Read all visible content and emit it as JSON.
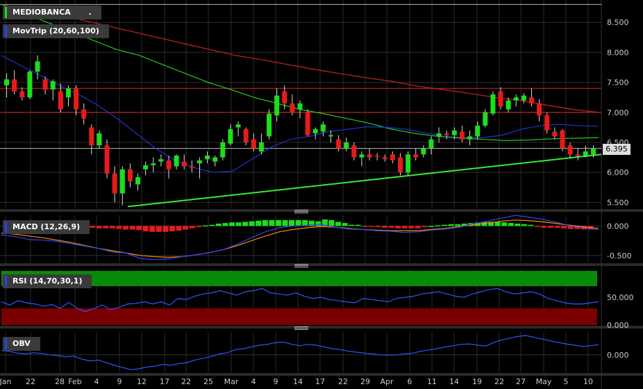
{
  "chart_data": [
    {
      "type": "candlestick",
      "title": "MEDIOBANCA",
      "title_suffix": ".",
      "overlay_label": "MovTrip (20,60,100)",
      "y_ticks": [
        "8.500",
        "8.000",
        "7.500",
        "7.000",
        "6.500",
        "6.000",
        "5.500"
      ],
      "ylim": [
        5.4,
        8.85
      ],
      "last_price": "6.395",
      "x_ticks": [
        "Jan",
        "22",
        "28",
        "Feb",
        "4",
        "9",
        "12",
        "17",
        "22",
        "25",
        "Mar",
        "4",
        "9",
        "14",
        "17",
        "22",
        "29",
        "Apr",
        "6",
        "11",
        "14",
        "19",
        "22",
        "27",
        "May",
        "5",
        "10"
      ],
      "candles": [
        [
          7.45,
          7.65,
          7.25,
          7.55
        ],
        [
          7.55,
          7.7,
          7.3,
          7.35
        ],
        [
          7.35,
          7.42,
          7.2,
          7.25
        ],
        [
          7.25,
          7.7,
          7.22,
          7.68
        ],
        [
          7.68,
          7.95,
          7.55,
          7.85
        ],
        [
          7.55,
          7.6,
          7.3,
          7.38
        ],
        [
          7.38,
          7.55,
          7.2,
          7.52
        ],
        [
          7.35,
          7.48,
          7.0,
          7.05
        ],
        [
          7.25,
          7.45,
          7.1,
          7.4
        ],
        [
          7.4,
          7.45,
          6.95,
          7.05
        ],
        [
          7.05,
          7.15,
          6.8,
          6.9
        ],
        [
          6.75,
          6.8,
          6.3,
          6.45
        ],
        [
          6.45,
          6.7,
          6.4,
          6.65
        ],
        [
          6.45,
          6.55,
          5.9,
          5.98
        ],
        [
          5.98,
          6.1,
          5.5,
          5.65
        ],
        [
          5.65,
          6.1,
          5.45,
          6.05
        ],
        [
          6.05,
          6.15,
          5.75,
          5.85
        ],
        [
          5.8,
          5.98,
          5.7,
          5.92
        ],
        [
          6.05,
          6.18,
          5.95,
          6.12
        ],
        [
          6.12,
          6.25,
          6.0,
          6.15
        ],
        [
          6.18,
          6.3,
          6.1,
          6.22
        ],
        [
          6.2,
          6.28,
          5.9,
          6.05
        ],
        [
          6.1,
          6.3,
          6.05,
          6.28
        ],
        [
          6.18,
          6.3,
          6.05,
          6.1
        ],
        [
          6.1,
          6.2,
          6.0,
          6.08
        ],
        [
          6.15,
          6.25,
          5.9,
          6.2
        ],
        [
          6.22,
          6.35,
          6.15,
          6.28
        ],
        [
          6.18,
          6.28,
          6.1,
          6.25
        ],
        [
          6.25,
          6.55,
          6.2,
          6.5
        ],
        [
          6.48,
          6.8,
          6.45,
          6.72
        ],
        [
          6.75,
          6.85,
          6.6,
          6.8
        ],
        [
          6.72,
          6.75,
          6.45,
          6.5
        ],
        [
          6.55,
          6.65,
          6.35,
          6.4
        ],
        [
          6.35,
          6.65,
          6.3,
          6.5
        ],
        [
          6.6,
          7.05,
          6.55,
          6.98
        ],
        [
          6.95,
          7.4,
          6.85,
          7.28
        ],
        [
          7.35,
          7.45,
          7.05,
          7.15
        ],
        [
          7.15,
          7.3,
          6.95,
          7.0
        ],
        [
          7.05,
          7.2,
          6.9,
          7.15
        ],
        [
          7.0,
          7.05,
          6.6,
          6.62
        ],
        [
          6.65,
          6.75,
          6.55,
          6.72
        ],
        [
          6.68,
          6.85,
          6.6,
          6.8
        ],
        [
          6.6,
          6.7,
          6.5,
          6.62
        ],
        [
          6.55,
          6.62,
          6.35,
          6.4
        ],
        [
          6.4,
          6.58,
          6.35,
          6.5
        ],
        [
          6.45,
          6.5,
          6.2,
          6.25
        ],
        [
          6.25,
          6.35,
          6.1,
          6.3
        ],
        [
          6.3,
          6.4,
          6.2,
          6.25
        ],
        [
          6.28,
          6.32,
          6.2,
          6.27
        ],
        [
          6.25,
          6.3,
          6.18,
          6.22
        ],
        [
          6.3,
          6.35,
          6.15,
          6.2
        ],
        [
          6.25,
          6.32,
          5.95,
          6.0
        ],
        [
          6.0,
          6.35,
          5.95,
          6.3
        ],
        [
          6.3,
          6.4,
          6.2,
          6.25
        ],
        [
          6.3,
          6.45,
          6.25,
          6.4
        ],
        [
          6.4,
          6.6,
          6.3,
          6.55
        ],
        [
          6.6,
          6.75,
          6.5,
          6.65
        ],
        [
          6.65,
          6.7,
          6.55,
          6.62
        ],
        [
          6.62,
          6.75,
          6.55,
          6.7
        ],
        [
          6.68,
          6.78,
          6.5,
          6.55
        ],
        [
          6.55,
          6.7,
          6.45,
          6.6
        ],
        [
          6.6,
          6.85,
          6.55,
          6.78
        ],
        [
          6.78,
          7.05,
          6.75,
          7.0
        ],
        [
          6.98,
          7.35,
          6.95,
          7.3
        ],
        [
          7.35,
          7.42,
          7.05,
          7.1
        ],
        [
          7.05,
          7.25,
          7.0,
          7.2
        ],
        [
          7.2,
          7.3,
          7.1,
          7.25
        ],
        [
          7.2,
          7.32,
          7.15,
          7.28
        ],
        [
          7.25,
          7.4,
          7.1,
          7.15
        ],
        [
          7.15,
          7.22,
          6.85,
          6.95
        ],
        [
          6.95,
          7.0,
          6.65,
          6.7
        ],
        [
          6.68,
          6.75,
          6.55,
          6.6
        ],
        [
          6.7,
          6.72,
          6.35,
          6.4
        ],
        [
          6.45,
          6.5,
          6.25,
          6.3
        ],
        [
          6.3,
          6.4,
          6.2,
          6.27
        ],
        [
          6.28,
          6.45,
          6.25,
          6.35
        ],
        [
          6.3,
          6.45,
          6.25,
          6.4
        ]
      ],
      "ma20": [
        7.95,
        7.78,
        7.62,
        7.45,
        7.3,
        7.12,
        6.9,
        6.65,
        6.4,
        6.2,
        6.08,
        6.0,
        6.02,
        6.22,
        6.42,
        6.55,
        6.6,
        6.68,
        6.72,
        6.76,
        6.75,
        6.72,
        6.66,
        6.6,
        6.58,
        6.58,
        6.62,
        6.72,
        6.78,
        6.8,
        6.78,
        6.77
      ],
      "ma60": [
        8.8,
        8.65,
        8.5,
        8.35,
        8.2,
        8.05,
        7.95,
        7.8,
        7.65,
        7.5,
        7.38,
        7.25,
        7.15,
        7.05,
        6.98,
        6.9,
        6.82,
        6.72,
        6.65,
        6.6,
        6.57,
        6.55,
        6.53,
        6.54,
        6.56,
        6.57,
        6.58
      ],
      "ma100": [
        8.8,
        8.72,
        8.65,
        8.55,
        8.45,
        8.35,
        8.25,
        8.15,
        8.05,
        7.95,
        7.88,
        7.8,
        7.72,
        7.65,
        7.58,
        7.52,
        7.44,
        7.38,
        7.32,
        7.25,
        7.2,
        7.12,
        7.05,
        7.0
      ],
      "h_levels": [
        8.8,
        7.4,
        7.0,
        6.4
      ],
      "trendline": [
        [
          0,
          5.43
        ],
        [
          1,
          6.3
        ]
      ]
    },
    {
      "type": "histogram+lines",
      "title": "MACD (12,26,9)",
      "y_ticks": [
        "0.000",
        "-0.500"
      ],
      "ylim": [
        -0.62,
        0.18
      ],
      "histogram": [
        -0.03,
        -0.03,
        -0.03,
        -0.04,
        -0.04,
        -0.04,
        -0.05,
        -0.06,
        -0.06,
        -0.07,
        -0.09,
        -0.1,
        -0.1,
        -0.1,
        -0.09,
        -0.08,
        -0.06,
        -0.04,
        -0.02,
        0.01,
        0.02,
        0.04,
        0.05,
        0.06,
        0.06,
        0.07,
        0.08,
        0.09,
        0.1,
        0.1,
        0.1,
        0.1,
        0.1,
        0.1,
        0.1,
        0.09,
        0.08,
        0.11,
        0.1,
        0.07,
        0.05,
        0.02,
        0.02,
        -0.01,
        -0.01,
        -0.02,
        -0.03,
        -0.03,
        -0.04,
        -0.04,
        -0.04,
        -0.04,
        -0.02,
        0.0,
        0.01,
        0.02,
        0.03,
        0.03,
        0.04,
        0.05,
        0.06,
        0.07,
        0.07,
        0.07,
        0.06,
        0.05,
        0.04,
        0.03,
        0.02,
        -0.01,
        -0.03,
        -0.03,
        -0.03,
        -0.04,
        -0.05,
        -0.05,
        -0.06,
        -0.06
      ],
      "macd": [
        -0.15,
        -0.18,
        -0.23,
        -0.24,
        -0.26,
        -0.3,
        -0.34,
        -0.38,
        -0.44,
        -0.46,
        -0.55,
        -0.57,
        -0.56,
        -0.52,
        -0.49,
        -0.45,
        -0.4,
        -0.31,
        -0.2,
        -0.1,
        -0.03,
        0.0,
        0.01,
        0.03,
        -0.02,
        -0.05,
        -0.06,
        -0.08,
        -0.09,
        -0.11,
        -0.1,
        -0.07,
        -0.05,
        -0.02,
        0.04,
        0.08,
        0.13,
        0.18,
        0.15,
        0.11,
        0.06,
        0.0,
        -0.04,
        -0.06
      ],
      "signal": [
        -0.12,
        -0.14,
        -0.17,
        -0.2,
        -0.24,
        -0.28,
        -0.33,
        -0.38,
        -0.42,
        -0.46,
        -0.5,
        -0.52,
        -0.53,
        -0.52,
        -0.49,
        -0.45,
        -0.4,
        -0.33,
        -0.25,
        -0.17,
        -0.1,
        -0.06,
        -0.03,
        -0.01,
        -0.02,
        -0.04,
        -0.06,
        -0.07,
        -0.08,
        -0.08,
        -0.08,
        -0.06,
        -0.04,
        -0.01,
        0.02,
        0.05,
        0.08,
        0.1,
        0.09,
        0.07,
        0.04,
        0.01,
        -0.02,
        -0.04
      ]
    },
    {
      "type": "line",
      "title": "RSI (14,70,30,1)",
      "y_ticks": [
        "50.000",
        "0.000"
      ],
      "ylim": [
        0,
        100
      ],
      "overbought": 70,
      "oversold": 30,
      "values": [
        42,
        36,
        44,
        40,
        38,
        34,
        37,
        30,
        41,
        30,
        24,
        30,
        36,
        28,
        32,
        38,
        39,
        42,
        38,
        42,
        36,
        48,
        46,
        52,
        56,
        58,
        62,
        58,
        54,
        60,
        62,
        66,
        58,
        56,
        54,
        58,
        52,
        48,
        50,
        46,
        44,
        42,
        40,
        48,
        46,
        44,
        42,
        48,
        50,
        52,
        56,
        58,
        60,
        56,
        52,
        50,
        56,
        60,
        64,
        66,
        60,
        56,
        58,
        60,
        56,
        48,
        44,
        40,
        38,
        38,
        40,
        42
      ]
    },
    {
      "type": "line",
      "title": "OBV",
      "y_ticks": [
        "0.000"
      ],
      "ylim": [
        -1.0,
        1.3
      ],
      "values": [
        0.25,
        0.2,
        0.1,
        0.05,
        0.12,
        0.08,
        0.0,
        -0.05,
        -0.12,
        -0.08,
        -0.25,
        -0.35,
        -0.3,
        -0.45,
        -0.6,
        -0.72,
        -0.85,
        -0.8,
        -0.7,
        -0.65,
        -0.55,
        -0.6,
        -0.5,
        -0.45,
        -0.3,
        -0.2,
        -0.1,
        0.05,
        0.12,
        0.3,
        0.35,
        0.45,
        0.55,
        0.6,
        0.7,
        0.72,
        0.6,
        0.52,
        0.6,
        0.55,
        0.45,
        0.35,
        0.3,
        0.2,
        0.15,
        0.1,
        0.05,
        0.0,
        -0.02,
        0.0,
        0.05,
        0.1,
        0.2,
        0.28,
        0.35,
        0.45,
        0.52,
        0.6,
        0.62,
        0.55,
        0.5,
        0.7,
        0.85,
        0.95,
        1.05,
        1.1,
        1.0,
        0.9,
        0.8,
        0.7,
        0.62,
        0.55,
        0.48,
        0.52,
        0.58
      ]
    }
  ],
  "colors": {
    "up": "#19e019",
    "down": "#e81a1a",
    "ma20": "#2233cc",
    "ma60": "#22cc22",
    "ma100": "#cc2222",
    "trend": "#33ee33",
    "rsi_top": "#0a8a0a",
    "rsi_bottom": "#7a0000",
    "signal": "#ff8c00"
  }
}
